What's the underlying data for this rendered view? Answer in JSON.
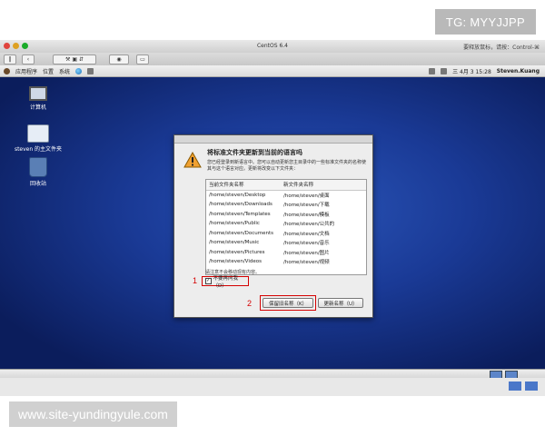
{
  "overlay": {
    "tag": "TG: MYYJJPP",
    "site": "www.site-yundingyule.com"
  },
  "mac": {
    "window_title": "CentOS 6.4",
    "right_hint": "要释放鼠标，请按：Control-⌘"
  },
  "panel": {
    "menus": [
      "应用程序",
      "位置",
      "系统"
    ],
    "datetime": "三 4月  3 15:28",
    "user": "Steven.Kuang"
  },
  "desktop": {
    "icons": [
      {
        "label": "计算机"
      },
      {
        "label": "steven 的主文件夹"
      },
      {
        "label": "回收站"
      }
    ]
  },
  "dialog": {
    "heading": "将标准文件夹更新到当前的语言吗",
    "description": "您已经登录到新语言中。您可以自动更新您主目录中的一些标准文件夹的名称使其与这个语言对应。更新将改变以下文件夹：",
    "table": {
      "headers": [
        "当前文件夹名称",
        "新文件夹名称"
      ],
      "rows": [
        [
          "/home/steven/Desktop",
          "/home/steven/桌面"
        ],
        [
          "/home/steven/Downloads",
          "/home/steven/下载"
        ],
        [
          "/home/steven/Templates",
          "/home/steven/模板"
        ],
        [
          "/home/steven/Public",
          "/home/steven/公共的"
        ],
        [
          "/home/steven/Documents",
          "/home/steven/文档"
        ],
        [
          "/home/steven/Music",
          "/home/steven/音乐"
        ],
        [
          "/home/steven/Pictures",
          "/home/steven/图片"
        ],
        [
          "/home/steven/Videos",
          "/home/steven/视频"
        ]
      ]
    },
    "note": "请注意不会移动现有内容。",
    "checkbox_label": "不要再问我（D）",
    "checkbox_checked": "✓",
    "keep_button": "保留旧名称（K）",
    "update_button": "更新名称（U）",
    "marker_1": "1",
    "marker_2": "2"
  }
}
